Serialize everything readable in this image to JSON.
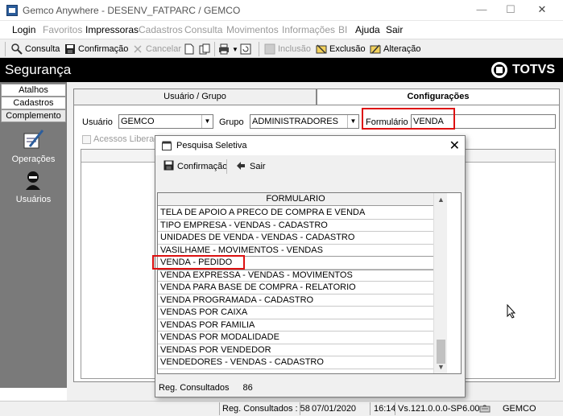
{
  "window": {
    "title": "Gemco Anywhere - DESENV_FATPARC / GEMCO",
    "minimize": "—",
    "maximize": "☐",
    "close": "✕"
  },
  "menu": [
    {
      "label": "Login",
      "enabled": true
    },
    {
      "label": "Favoritos",
      "enabled": false
    },
    {
      "label": "Impressoras",
      "enabled": true
    },
    {
      "label": "Cadastros",
      "enabled": false
    },
    {
      "label": "Consulta",
      "enabled": false
    },
    {
      "label": "Movimentos",
      "enabled": false
    },
    {
      "label": "Informações",
      "enabled": false
    },
    {
      "label": "BI",
      "enabled": false
    },
    {
      "label": "Ajuda",
      "enabled": true
    },
    {
      "label": "Sair",
      "enabled": true
    }
  ],
  "toolbar": {
    "consulta": "Consulta",
    "confirmacao": "Confirmação",
    "cancelar": "Cancelar",
    "inclusao": "Inclusão",
    "exclusao": "Exclusão",
    "alteracao": "Alteração"
  },
  "header": {
    "title": "Segurança",
    "brand": "TOTVS"
  },
  "sidebar": {
    "tabs": [
      "Atalhos",
      "Cadastros",
      "Complemento"
    ],
    "items": [
      {
        "label": "Operações",
        "icon": "operations-icon"
      },
      {
        "label": "Usuários",
        "icon": "users-icon"
      }
    ]
  },
  "tabs": [
    {
      "label": "Usuário  / Grupo",
      "active": false
    },
    {
      "label": "Configurações",
      "active": true
    }
  ],
  "form": {
    "usuario_label": "Usuário",
    "usuario_value": "GEMCO",
    "grupo_label": "Grupo",
    "grupo_value": "ADMINISTRADORES",
    "formulario_label": "Formulário",
    "formulario_value": "VENDA",
    "acessos_label": "Acessos Liberados"
  },
  "dialog": {
    "title": "Pesquisa Seletiva",
    "confirm_label": "Confirmação",
    "exit_label": "Sair",
    "column_header": "FORMULARIO",
    "rows": [
      "TELA DE APOIO A PRECO DE COMPRA E VENDA",
      "TIPO EMPRESA - VENDAS - CADASTRO",
      "UNIDADES DE VENDA - VENDAS - CADASTRO",
      "VASILHAME - MOVIMENTOS - VENDAS",
      "VENDA - PEDIDO",
      "VENDA EXPRESSA - VENDAS - MOVIMENTOS",
      "VENDA PARA BASE DE COMPRA - RELATORIO",
      "VENDA PROGRAMADA - CADASTRO",
      "VENDAS POR CAIXA",
      "VENDAS POR FAMILIA",
      "VENDAS POR MODALIDADE",
      "VENDAS POR VENDEDOR",
      "VENDEDORES - VENDAS - CADASTRO"
    ],
    "selected_row": "VENDA - PEDIDO",
    "footer_label": "Reg. Consultados",
    "footer_count": "86"
  },
  "status": {
    "reg": "Reg. Consultados : 58",
    "date": "07/01/2020",
    "time": "16:14",
    "version": "Vs.121.0.0.0-SP6.00.2",
    "user": "GEMCO"
  },
  "colors": {
    "header_bg": "#000000",
    "sidebar_bg": "#7a7a7a",
    "highlight": "#dd1111"
  }
}
